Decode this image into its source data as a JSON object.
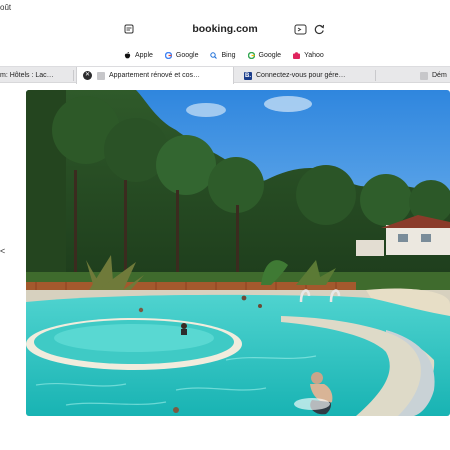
{
  "corner_text": "oût",
  "left_glyph": "<",
  "address_bar": {
    "url": "booking.com",
    "reader_icon": "reader-icon",
    "extension_icon": "extension-icon",
    "reload_icon": "reload-icon"
  },
  "favorites": [
    {
      "label": "Apple",
      "icon": "apple-icon"
    },
    {
      "label": "Google",
      "icon": "google-icon"
    },
    {
      "label": "Bing",
      "icon": "bing-icon"
    },
    {
      "label": "Google",
      "icon": "google-icon"
    },
    {
      "label": "Yahoo",
      "icon": "yahoo-icon"
    }
  ],
  "tabs": [
    {
      "label": "m: Hôtels : Lac…",
      "active": false
    },
    {
      "label": "Appartement rénové et cos…",
      "active": true
    },
    {
      "label": "Connectez-vous pour gére…",
      "active": false
    },
    {
      "label": "Dém",
      "active": false
    }
  ],
  "photo": {
    "subject": "resort-pool-photo"
  },
  "colors": {
    "tab_strip": "#e8e8ea",
    "pool": "#2ec4c0",
    "sky": "#3d8fe0",
    "booking_blue": "#1a3c8a"
  }
}
